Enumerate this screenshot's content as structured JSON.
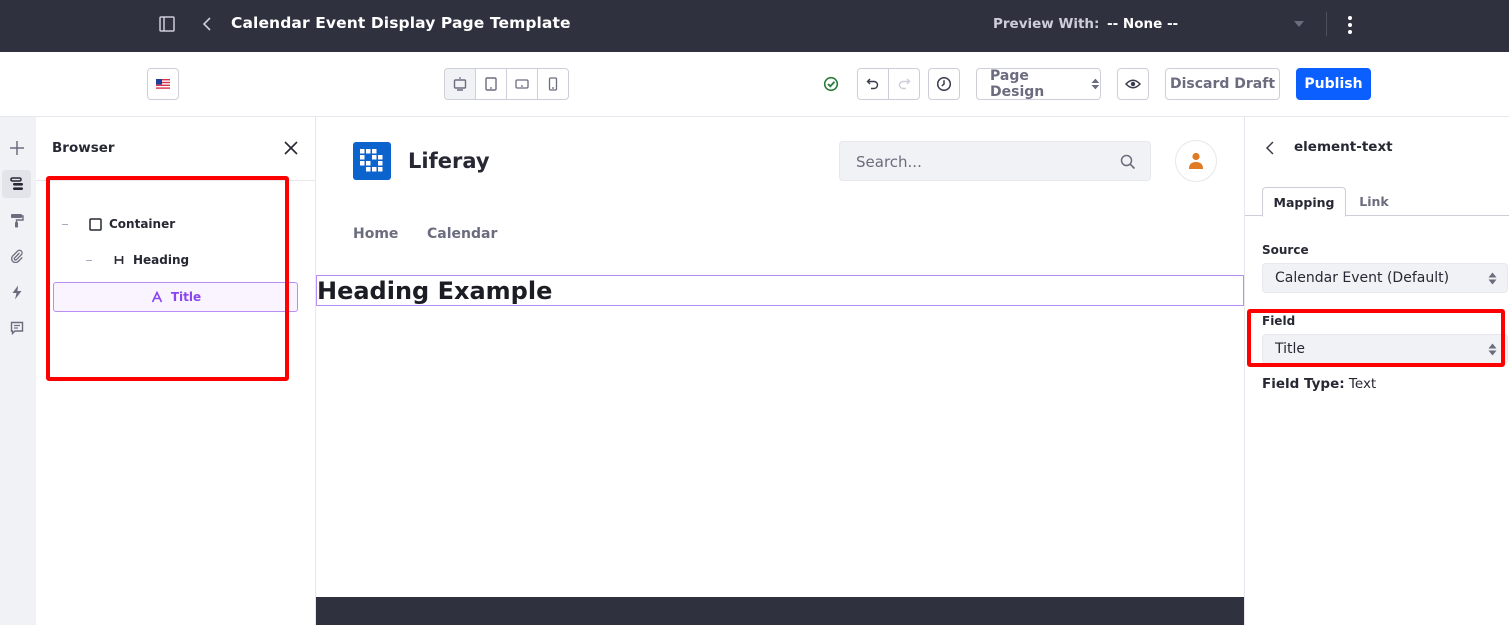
{
  "topbar": {
    "title": "Calendar Event Display Page Template",
    "preview_label": "Preview With:",
    "preview_value": "-- None --"
  },
  "toolbar": {
    "language": "en-US",
    "devices": [
      "desktop",
      "tablet",
      "landscape-phone",
      "portrait-phone"
    ],
    "active_device": "desktop",
    "page_design_label": "Page Design",
    "discard_label": "Discard Draft",
    "publish_label": "Publish",
    "colors": {
      "publish": "#0b5fff",
      "saved_check": "#287d3c"
    }
  },
  "rail": {
    "items": [
      {
        "icon": "plus-icon",
        "active": false
      },
      {
        "icon": "browser-icon",
        "active": true
      },
      {
        "icon": "paint-roller-icon",
        "active": false
      },
      {
        "icon": "paperclip-icon",
        "active": false
      },
      {
        "icon": "bolt-icon",
        "active": false
      },
      {
        "icon": "comment-icon",
        "active": false
      }
    ]
  },
  "browser": {
    "title": "Browser",
    "tree": [
      {
        "label": "Container",
        "icon": "square-icon",
        "level": 0
      },
      {
        "label": "Heading",
        "icon": "heading-icon",
        "level": 1
      },
      {
        "label": "Title",
        "icon": "text-icon",
        "level": 2,
        "selected": true
      }
    ]
  },
  "page": {
    "site_name": "Liferay",
    "search_placeholder": "Search...",
    "nav": [
      "Home",
      "Calendar"
    ],
    "heading": "Heading Example",
    "colors": {
      "logo": "#0b63ce",
      "avatar": "#e07b24",
      "selection": "#b98ef5"
    }
  },
  "panel": {
    "element_name": "element-text",
    "tabs": [
      {
        "label": "Mapping",
        "active": true
      },
      {
        "label": "Link",
        "active": false
      }
    ],
    "source_label": "Source",
    "source_value": "Calendar Event (Default)",
    "field_label": "Field",
    "field_value": "Title",
    "field_type_label": "Field Type:",
    "field_type_value": "Text"
  }
}
